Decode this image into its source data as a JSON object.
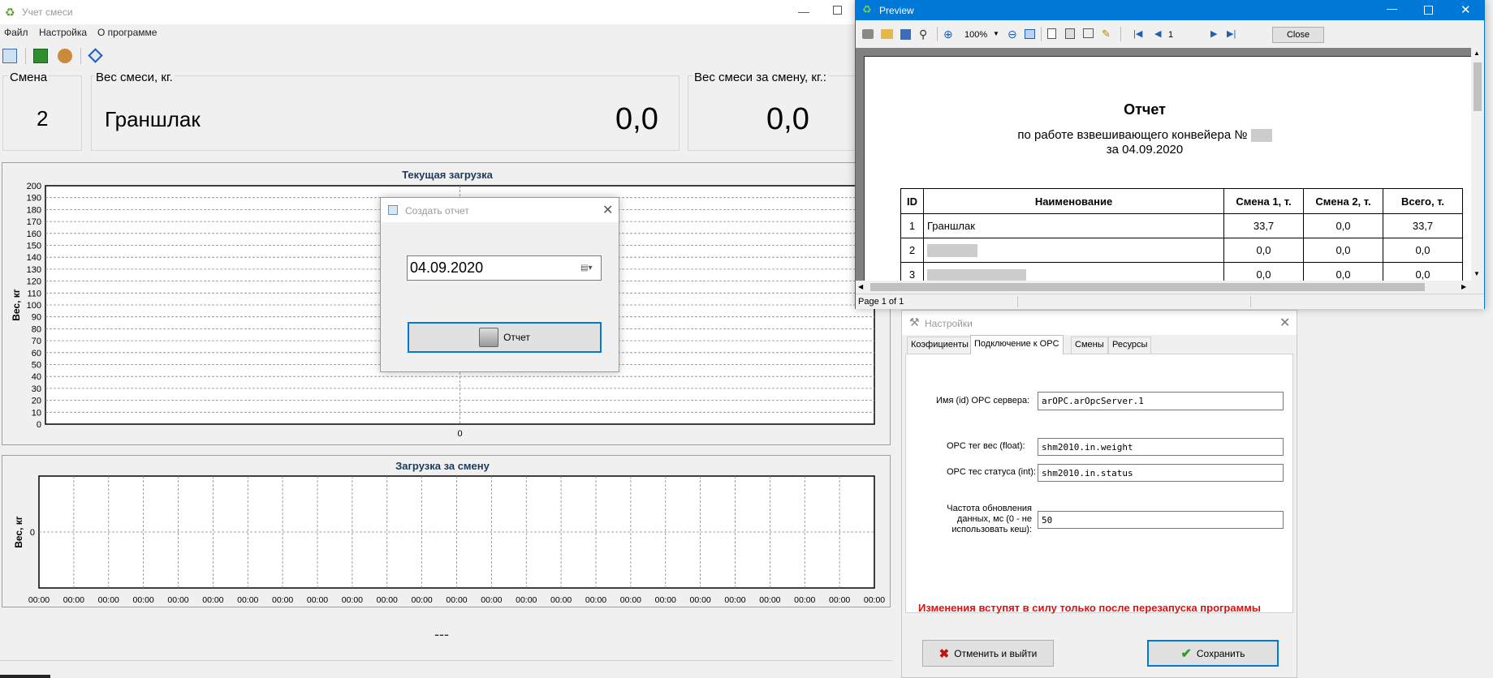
{
  "main": {
    "title": "Учет смеси",
    "menu": [
      "Файл",
      "Настройка",
      "О программе"
    ],
    "shift_label": "Смена",
    "shift_value": "2",
    "mix_weight_label": "Вес смеси, кг.",
    "mix_name": "Граншлак",
    "mix_weight_value": "0,0",
    "shift_weight_label": "Вес смеси за смену, кг.:",
    "shift_weight_value": "0,0",
    "status_text": "---"
  },
  "chart_data": [
    {
      "type": "line",
      "title": "Текущая загрузка",
      "ylabel": "Вес, кг",
      "xlabel": "",
      "ylim": [
        0,
        200
      ],
      "yticks": [
        0,
        10,
        20,
        30,
        40,
        50,
        60,
        70,
        80,
        90,
        100,
        110,
        120,
        130,
        140,
        150,
        160,
        170,
        180,
        190,
        200
      ],
      "xticks": [
        "0"
      ],
      "series": [],
      "grid": true
    },
    {
      "type": "line",
      "title": "Загрузка за смену",
      "ylabel": "Вес, кг",
      "xlabel": "",
      "yticks": [
        0
      ],
      "xticks": [
        "00:00",
        "00:00",
        "00:00",
        "00:00",
        "00:00",
        "00:00",
        "00:00",
        "00:00",
        "00:00",
        "00:00",
        "00:00",
        "00:00",
        "00:00",
        "00:00",
        "00:00",
        "00:00",
        "00:00",
        "00:00",
        "00:00",
        "00:00",
        "00:00",
        "00:00",
        "00:00",
        "00:00",
        "00:00"
      ],
      "series": [],
      "grid": true
    }
  ],
  "dialog": {
    "title": "Создать отчет",
    "date_value": "04.09.2020",
    "report_button": "Отчет"
  },
  "preview": {
    "title": "Preview",
    "zoom": "100%",
    "page_input": "1",
    "close_button": "Close",
    "status": "Page 1 of 1",
    "report_title": "Отчет",
    "report_subtitle": "по работе взвешивающего конвейера №",
    "report_date": "за 04.09.2020",
    "table_headers": [
      "ID",
      "Наименование",
      "Смена 1, т.",
      "Смена 2, т.",
      "Всего, т."
    ],
    "table_rows": [
      [
        "1",
        "Граншлак",
        "33,7",
        "0,0",
        "33,7"
      ],
      [
        "2",
        "",
        "0,0",
        "0,0",
        "0,0"
      ],
      [
        "3",
        "",
        "0,0",
        "0,0",
        "0,0"
      ]
    ]
  },
  "settings": {
    "title": "Настройки",
    "tabs": [
      "Коэфициенты",
      "Подключение к OPC",
      "Смены",
      "Ресурсы"
    ],
    "server_label": "Имя (id) OPC сервера:",
    "server_value": "arOPC.arOpcServer.1",
    "weight_tag_label": "OPC тег вес (float):",
    "weight_tag_value": "shm2010.in.weight",
    "status_tag_label": "OPC тес статуса (int):",
    "status_tag_value": "shm2010.in.status",
    "update_label_1": "Частота обновления",
    "update_label_2": "данных, мс (0 - не",
    "update_label_3": "использовать кеш):",
    "update_value": "50",
    "warning": "Изменения вступят в силу только после перезапуска программы",
    "cancel_button": "Отменить и выйти",
    "save_button": "Сохранить"
  }
}
